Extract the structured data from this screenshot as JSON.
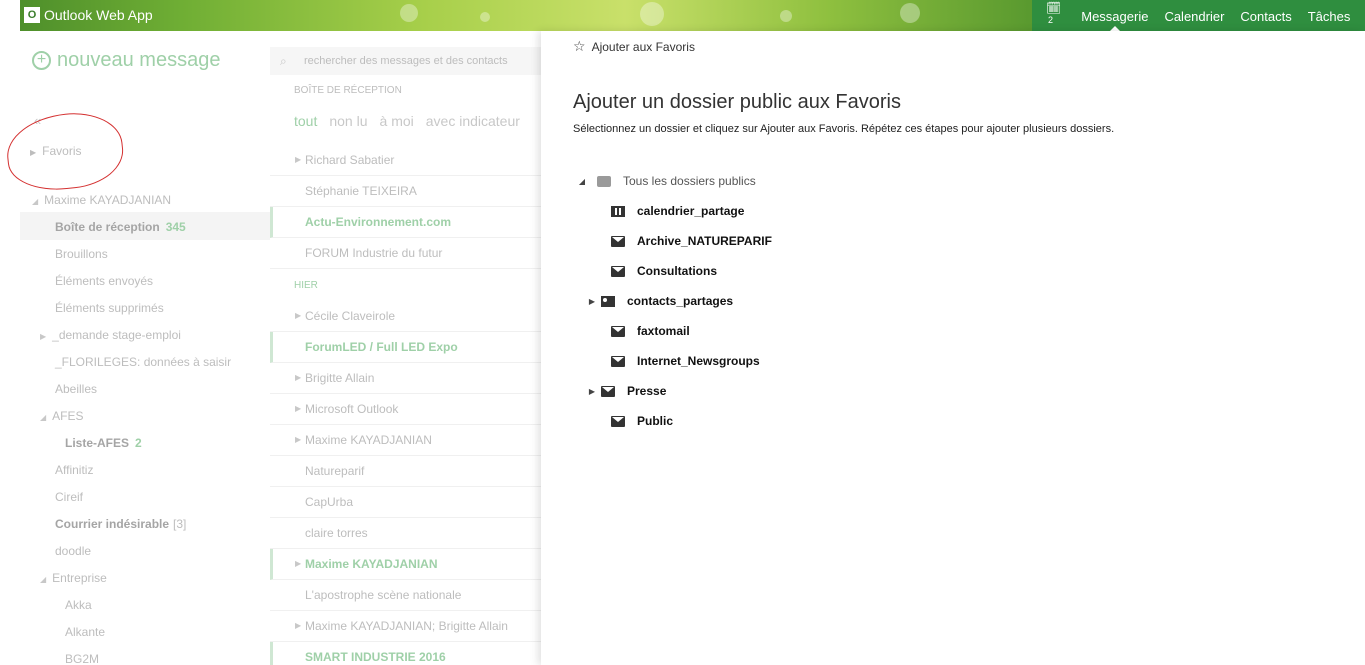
{
  "topbar": {
    "app_title": "Outlook Web App",
    "logo_letter": "O",
    "calendar_badge": "2",
    "nav": [
      "Messagerie",
      "Calendrier",
      "Contacts",
      "Tâches"
    ],
    "active_nav": "Messagerie"
  },
  "left": {
    "new_message": "nouveau message",
    "collapse_glyph": "«",
    "favoris": "Favoris",
    "account": "Maxime KAYADJANIAN",
    "folders": [
      {
        "label": "Boîte de réception",
        "count": "345"
      },
      {
        "label": "Brouillons"
      },
      {
        "label": "Éléments envoyés"
      },
      {
        "label": "Éléments supprimés"
      },
      {
        "label": "_demande stage-emploi"
      },
      {
        "label": "_FLORILEGES: données à saisir"
      },
      {
        "label": "Abeilles"
      },
      {
        "label": "AFES"
      },
      {
        "label": "Liste-AFES",
        "count": "2"
      },
      {
        "label": "Affinitiz"
      },
      {
        "label": "Cireif"
      },
      {
        "label": "Courrier indésirable",
        "bracket": "[3]"
      },
      {
        "label": "doodle"
      },
      {
        "label": "Entreprise"
      },
      {
        "label": "Akka"
      },
      {
        "label": "Alkante"
      },
      {
        "label": "BG2M"
      }
    ]
  },
  "middle": {
    "search_placeholder": "rechercher des messages et des contacts",
    "inbox_header": "BOÎTE DE RÉCEPTION",
    "filters": [
      "tout",
      "non lu",
      "à moi",
      "avec indicateur"
    ],
    "group_yesterday": "HIER",
    "messages": [
      "Richard Sabatier",
      "Stéphanie TEIXEIRA",
      "Actu-Environnement.com",
      "FORUM Industrie du futur",
      "Cécile Claveirole",
      "ForumLED / Full LED Expo",
      "Brigitte Allain",
      "Microsoft Outlook",
      "Maxime KAYADJANIAN",
      "Natureparif",
      "CapUrba",
      "claire torres",
      "Maxime KAYADJANIAN",
      "L'apostrophe scène nationale",
      "Maxime KAYADJANIAN; Brigitte Allain",
      "SMART INDUSTRIE 2016"
    ]
  },
  "dialog": {
    "add_to_favorites": "Ajouter aux Favoris",
    "title": "Ajouter un dossier public aux Favoris",
    "subtitle": "Sélectionnez un dossier et cliquez sur Ajouter aux Favoris. Répétez ces étapes pour ajouter plusieurs dossiers.",
    "root_folder": "Tous les dossiers publics",
    "folders": [
      {
        "label": "calendrier_partage",
        "icon": "calendar-icon"
      },
      {
        "label": "Archive_NATUREPARIF",
        "icon": "mail-folder-icon"
      },
      {
        "label": "Consultations",
        "icon": "mail-folder-icon"
      },
      {
        "label": "contacts_partages",
        "icon": "contacts-icon"
      },
      {
        "label": "faxtomail",
        "icon": "mail-folder-icon"
      },
      {
        "label": "Internet_Newsgroups",
        "icon": "mail-folder-icon"
      },
      {
        "label": "Presse",
        "icon": "mail-folder-icon"
      },
      {
        "label": "Public",
        "icon": "mail-folder-icon"
      }
    ]
  },
  "colors": {
    "brand_green": "#2f8e3f",
    "annotation_red": "#d43030"
  }
}
